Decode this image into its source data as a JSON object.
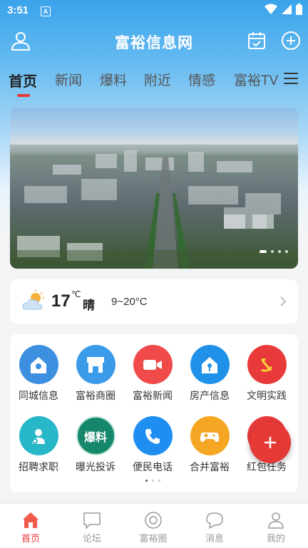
{
  "status_bar": {
    "time": "3:51",
    "notif_badge": "A"
  },
  "app": {
    "title": "富裕信息网"
  },
  "tabs": [
    {
      "label": "首页",
      "active": true
    },
    {
      "label": "新闻"
    },
    {
      "label": "爆料"
    },
    {
      "label": "附近"
    },
    {
      "label": "情感"
    },
    {
      "label": "富裕TV"
    }
  ],
  "weather": {
    "temp": "17",
    "unit": "℃",
    "condition": "晴",
    "range": "9~20°C"
  },
  "services": [
    {
      "label": "同城信息",
      "icon": "home-pin-icon",
      "color": "#3d8fe0"
    },
    {
      "label": "富裕商圈",
      "icon": "shop-icon",
      "color": "#3b9be8"
    },
    {
      "label": "富裕新闻",
      "icon": "video-camera-icon",
      "color": "#f04a4a"
    },
    {
      "label": "房产信息",
      "icon": "house-key-icon",
      "color": "#1f91e8"
    },
    {
      "label": "文明实践",
      "icon": "party-emblem-icon",
      "color": "#e83a3a"
    },
    {
      "label": "招聘求职",
      "icon": "job-search-icon",
      "color": "#26b7c9"
    },
    {
      "label": "曝光投诉",
      "icon": "expose-badge-icon",
      "badge_text": "爆料",
      "color": "#16876a"
    },
    {
      "label": "便民电话",
      "icon": "phone-icon",
      "color": "#1e8ff0"
    },
    {
      "label": "合并富裕",
      "icon": "gamepad-icon",
      "color": "#f5a623"
    },
    {
      "label": "红包任务",
      "icon": "red-packet-icon",
      "color": "#e83a3a"
    }
  ],
  "bottom_nav": [
    {
      "label": "首页",
      "icon": "home-icon",
      "active": true
    },
    {
      "label": "论坛",
      "icon": "forum-icon"
    },
    {
      "label": "富裕圈",
      "icon": "circle-icon"
    },
    {
      "label": "消息",
      "icon": "message-icon"
    },
    {
      "label": "我的",
      "icon": "profile-icon"
    }
  ],
  "colors": {
    "accent": "#e53935",
    "header": "#3aa3eb"
  }
}
